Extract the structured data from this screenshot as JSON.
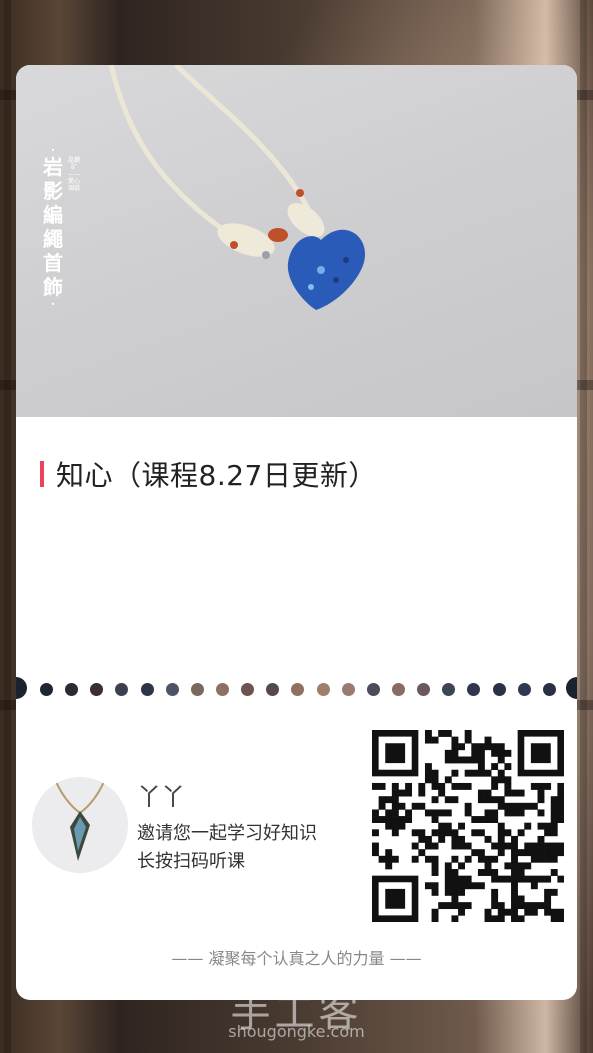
{
  "brand": {
    "dot_top": "·",
    "name": "岩影編繩首飾",
    "dot_bottom": "·",
    "small_text": "晶鑽矿——愛心項链"
  },
  "course": {
    "title": "知心（课程8.27日更新）",
    "accent_color": "#e8455c"
  },
  "user": {
    "name": "丫丫",
    "invite_text": "邀请您一起学习好知识",
    "press_text": "长按扫码听课"
  },
  "slogan": "—— 凝聚每个认真之人的力量 ——",
  "watermark": {
    "name": "手工客",
    "site": "shougongke.com"
  },
  "icons": {
    "qr": "qr-code-icon",
    "avatar": "necklace-pendant-avatar"
  }
}
